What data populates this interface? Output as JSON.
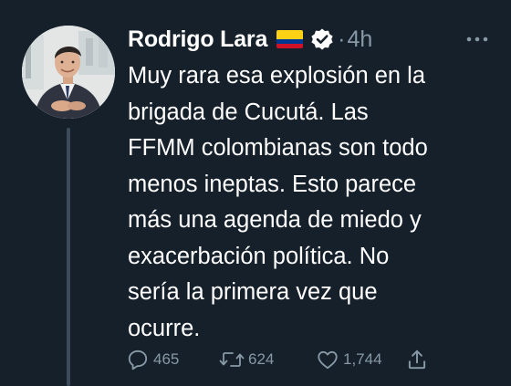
{
  "author": {
    "display_name": "Rodrigo Lara",
    "flag": "colombia-flag",
    "verified": true,
    "separator": "·",
    "timestamp": "4h"
  },
  "tweet": {
    "text": "Muy rara esa explosión en la\nbrigada de Cucutá. Las\nFFMM colombianas son todo\nmenos ineptas. Esto parece\nmás una agenda de miedo y\nexacerbación política.  No\nsería la primera vez que\nocurre."
  },
  "actions": {
    "reply_count": "465",
    "retweet_count": "624",
    "like_count": "1,744"
  },
  "icons": {
    "more": "more-horizontal-icon",
    "reply": "reply-icon",
    "retweet": "retweet-icon",
    "like": "heart-icon",
    "share": "share-icon"
  },
  "colors": {
    "background": "#15202b",
    "text": "#ffffff",
    "secondary": "#8899a6",
    "thread_line": "#3d4b59"
  }
}
